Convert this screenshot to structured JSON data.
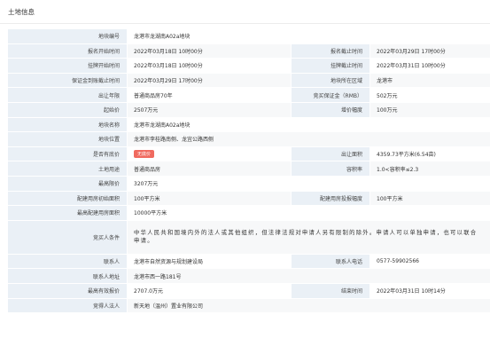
{
  "page": {
    "title": "土地信息"
  },
  "rows": [
    {
      "type": "single",
      "label": "地块编号",
      "value": "龙港市龙湖南A02a地块"
    },
    {
      "type": "pair",
      "label1": "报名开始时间",
      "value1": "2022年03月18日 10时00分",
      "label2": "报名截止时间",
      "value2": "2022年03月29日 17时00分"
    },
    {
      "type": "pair",
      "label1": "挂牌开始时间",
      "value1": "2022年03月18日 10时00分",
      "label2": "挂牌截止时间",
      "value2": "2022年03月31日 10时00分"
    },
    {
      "type": "pair",
      "label1": "保证金到账截止时间",
      "value1": "2022年03月29日 17时00分",
      "label2": "地块所在区域",
      "value2": "龙港市"
    },
    {
      "type": "pair",
      "label1": "出让年限",
      "value1": "普通商品房70年",
      "label2": "竞买保证金（RMB）",
      "value2": "502万元"
    },
    {
      "type": "pair",
      "label1": "起始价",
      "value1": "2507万元",
      "label2": "增价幅度",
      "value2": "100万元"
    },
    {
      "type": "single",
      "label": "地块名称",
      "value": "龙港市龙湖南A02a地块"
    },
    {
      "type": "single",
      "label": "地块位置",
      "value": "龙港市李桂路南侧、龙宜公路西侧"
    },
    {
      "type": "pair",
      "label1": "是否有底价",
      "value1": "",
      "badge": "无底价",
      "label2": "出让面积",
      "value2": "4359.73平方米(6.54亩)"
    },
    {
      "type": "pair",
      "label1": "土地用途",
      "value1": "普通商品房",
      "label2": "容积率",
      "value2": "1.0<容积率≤2.3"
    },
    {
      "type": "single",
      "label": "最高限价",
      "value": "3207万元"
    },
    {
      "type": "pair",
      "label1": "配建用房初始面积",
      "value1": "100平方米",
      "label2": "配建用房投报幅度",
      "value2": "100平方米"
    },
    {
      "type": "single",
      "label": "最高配建用房面积",
      "value": "10000平方米"
    },
    {
      "type": "tall",
      "label": "竞买人条件",
      "value": "中华人民共和国境内外的法人或其他组织，但法律法规对申请人另有限制的除外。申请人可以单独申请，也可以联合申请。"
    },
    {
      "type": "pair",
      "label1": "联系人",
      "value1": "龙港市自然资源与规划建设局",
      "label2": "联系人电话",
      "value2": "0577-59902566"
    },
    {
      "type": "single",
      "label": "联系人地址",
      "value": "龙港市西一路181号"
    },
    {
      "type": "pair",
      "label1": "最高有效报价",
      "value1": "2707.0万元",
      "label2": "结束时间",
      "value2": "2022年03月31日 10时14分"
    },
    {
      "type": "single",
      "label": "竞得人法人",
      "value": "新天地（温州）置业有限公司"
    }
  ]
}
